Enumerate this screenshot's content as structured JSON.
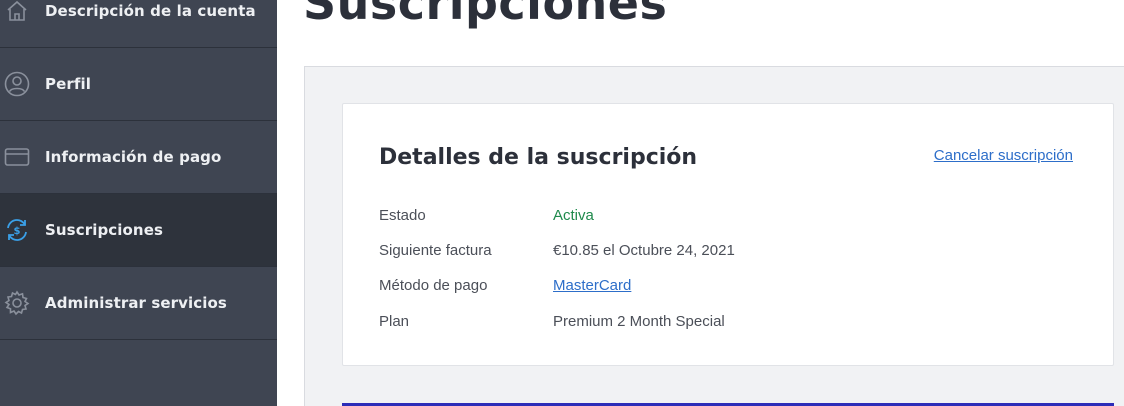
{
  "sidebar": {
    "items": [
      {
        "label": "Descripción de la cuenta",
        "icon": "home-icon"
      },
      {
        "label": "Perfil",
        "icon": "user-icon"
      },
      {
        "label": "Información de pago",
        "icon": "credit-card-icon"
      },
      {
        "label": "Suscripciones",
        "icon": "subscription-icon",
        "active": true
      },
      {
        "label": "Administrar servicios",
        "icon": "gear-icon"
      }
    ]
  },
  "main": {
    "title": "Suscripciones",
    "card": {
      "title": "Detalles de la suscripción",
      "cancel_label": "Cancelar suscripción",
      "rows": [
        {
          "label": "Estado",
          "value": "Activa"
        },
        {
          "label": "Siguiente factura",
          "value": "€10.85 el Octubre 24, 2021"
        },
        {
          "label": "Método de pago",
          "value": "MasterCard"
        },
        {
          "label": "Plan",
          "value": "Premium 2 Month Special"
        }
      ]
    }
  },
  "colors": {
    "sidebar_bg": "#3f4552",
    "sidebar_active_bg": "#2e333c",
    "accent_blue": "#2d6ec9",
    "status_green": "#1f8a4c",
    "bar_blue": "#2c2cb8"
  }
}
